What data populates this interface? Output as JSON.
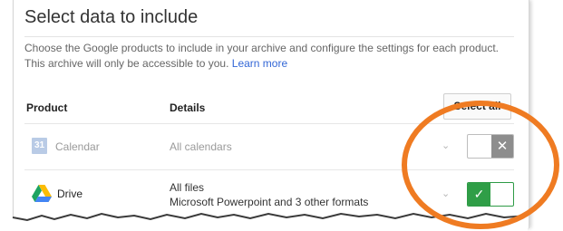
{
  "dialog": {
    "title": "Select data to include",
    "description": "Choose the Google products to include in your archive and configure the settings for each product. This archive will only be accessible to you.",
    "learn_more": "Learn more"
  },
  "table": {
    "headers": {
      "product": "Product",
      "details": "Details"
    },
    "select_all_label": "Select all",
    "rows": [
      {
        "icon": "calendar-icon",
        "icon_text": "31",
        "name": "Calendar",
        "details": [
          "All calendars"
        ],
        "enabled": false,
        "expand_glyph": "⌄"
      },
      {
        "icon": "google-drive-icon",
        "name": "Drive",
        "details": [
          "All files",
          "Microsoft Powerpoint and 3 other formats"
        ],
        "enabled": true,
        "expand_glyph": "⌄"
      }
    ]
  },
  "toggle_glyphs": {
    "off": "✕",
    "on": "✓"
  },
  "colors": {
    "toggle_on": "#2f9e47",
    "toggle_off": "#8d8d8d",
    "link": "#3367d6",
    "annotation_circle": "#ef7b22"
  }
}
